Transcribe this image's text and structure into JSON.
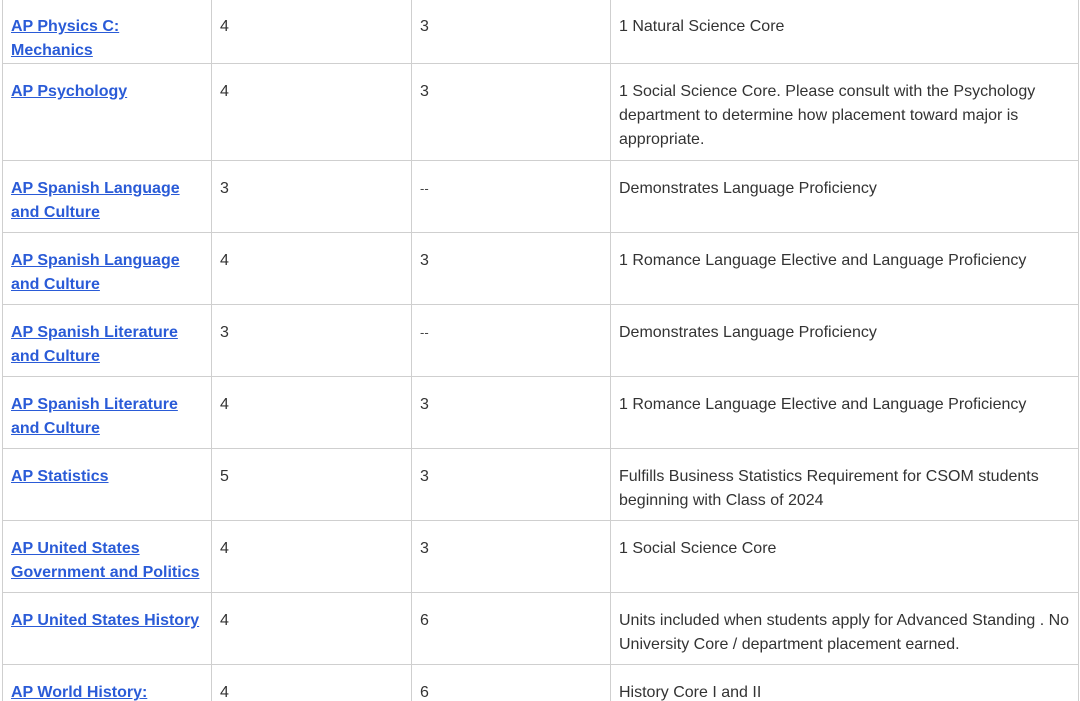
{
  "table": {
    "rows": [
      {
        "exam": "AP Physics C: Mechanics",
        "score": "4",
        "credits": "3",
        "notes": "1 Natural Science Core"
      },
      {
        "exam": "AP Psychology",
        "score": "4",
        "credits": "3",
        "notes": "1 Social Science Core. Please consult with the Psychology department to determine how placement toward major is appropriate."
      },
      {
        "exam": "AP Spanish Language and Culture",
        "score": "3",
        "credits": "--",
        "notes": "Demonstrates Language Proficiency"
      },
      {
        "exam": "AP Spanish Language and Culture",
        "score": "4",
        "credits": "3",
        "notes": "1 Romance Language Elective and Language Proficiency"
      },
      {
        "exam": "AP Spanish Literature and Culture",
        "score": "3",
        "credits": "--",
        "notes": "Demonstrates Language Proficiency"
      },
      {
        "exam": "AP Spanish Literature and Culture",
        "score": "4",
        "credits": "3",
        "notes": "1 Romance Language Elective and Language Proficiency"
      },
      {
        "exam": "AP Statistics",
        "score": "5",
        "credits": "3",
        "notes": "Fulfills Business Statistics Requirement for CSOM students beginning with Class of 2024"
      },
      {
        "exam": "AP United States Government and Politics",
        "score": "4",
        "credits": "3",
        "notes": "1 Social Science Core"
      },
      {
        "exam": "AP United States History",
        "score": "4",
        "credits": "6",
        "notes": "Units included when students apply for Advanced Standing . No University Core / department placement earned."
      },
      {
        "exam": "AP World History: Modern",
        "score": "4",
        "credits": "6",
        "notes": "History Core I and II"
      }
    ]
  },
  "colors": {
    "link": "#2a5bd7",
    "border": "#cfcfcf",
    "text": "#333333"
  }
}
